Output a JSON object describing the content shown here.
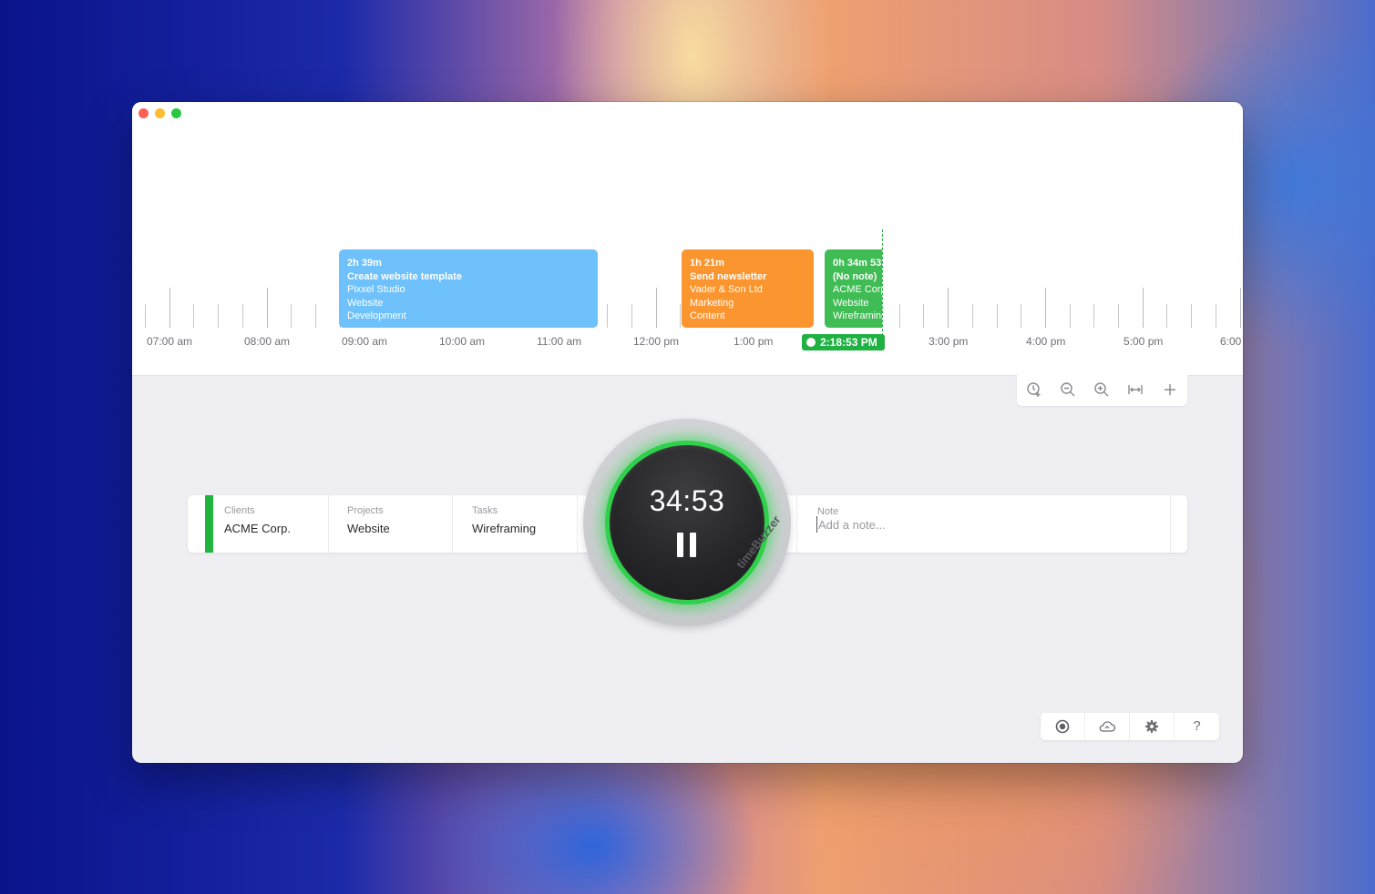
{
  "timeline": {
    "hour_labels": [
      "07:00 am",
      "08:00 am",
      "09:00 am",
      "10:00 am",
      "11:00 am",
      "12:00 pm",
      "1:00 pm",
      "3:00 pm",
      "4:00 pm",
      "5:00 pm",
      "6:00"
    ],
    "entries": [
      {
        "duration": "2h 39m",
        "title": "Create website template",
        "client": "Pixxel Studio",
        "project": "Website",
        "task": "Development",
        "color": "#6ec1fb"
      },
      {
        "duration": "1h 21m",
        "title": "Send newsletter",
        "client": "Vader & Son Ltd",
        "project": "Marketing",
        "task": "Content",
        "color": "#fb952f"
      },
      {
        "duration": "0h 34m 53",
        "title": "(No note)",
        "client": "ACME Corp.",
        "project": "Website",
        "task": "Wireframing",
        "color": "#3fbc54"
      }
    ],
    "current_time": "2:18:53 PM"
  },
  "zoom_toolbar": {
    "icons": [
      "clock-add-icon",
      "zoom-out-icon",
      "zoom-in-icon",
      "fit-width-icon",
      "plus-icon"
    ]
  },
  "tracker": {
    "accent_color": "#21b53f",
    "clients": {
      "label": "Clients",
      "value": "ACME Corp."
    },
    "projects": {
      "label": "Projects",
      "value": "Website"
    },
    "tasks": {
      "label": "Tasks",
      "value": "Wireframing"
    },
    "note": {
      "label": "Note",
      "placeholder": "Add a note..."
    }
  },
  "buzzer": {
    "elapsed": "34:53",
    "brand": "timeBuzzer",
    "ring_color": "#2fd04a"
  },
  "bottom_toolbar": {
    "icons": [
      "record-icon",
      "cloud-sync-icon",
      "settings-gear-icon",
      "help-icon"
    ],
    "help_glyph": "?"
  }
}
